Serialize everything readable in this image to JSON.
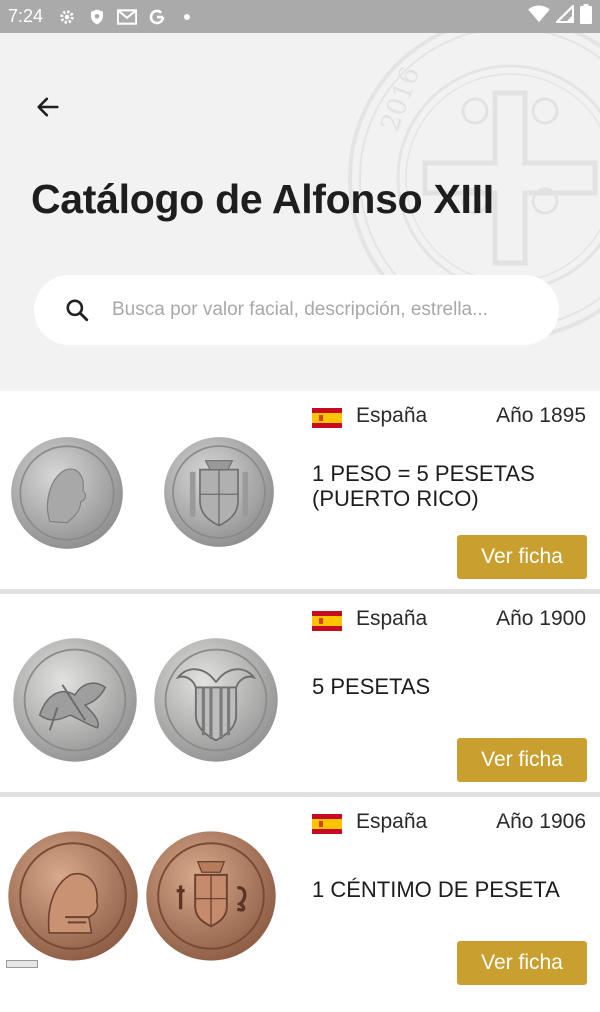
{
  "status_bar": {
    "time": "7:24",
    "left_icons": [
      "gear-icon",
      "shield-icon",
      "gmail-icon",
      "google-icon",
      "dot-icon"
    ],
    "right_icons": [
      "wifi-icon",
      "signal-icon",
      "battery-icon"
    ]
  },
  "header": {
    "title": "Catálogo de Alfonso XIII",
    "seal_text": "2016"
  },
  "search": {
    "placeholder": "Busca por valor facial, descripción, estrella..."
  },
  "coins": [
    {
      "country": "España",
      "year": "Año 1895",
      "name": "1 PESO = 5 PESETAS (PUERTO RICO)",
      "button": "Ver ficha",
      "metal": "silver"
    },
    {
      "country": "España",
      "year": "Año 1900",
      "name": "5 PESETAS",
      "button": "Ver ficha",
      "metal": "silver"
    },
    {
      "country": "España",
      "year": "Año 1906",
      "name": "1 CÉNTIMO DE PESETA",
      "button": "Ver ficha",
      "metal": "copper"
    }
  ],
  "colors": {
    "accent": "#c9a02f",
    "status_bar": "#aaaaaa",
    "header_bg": "#f2f2f2"
  }
}
